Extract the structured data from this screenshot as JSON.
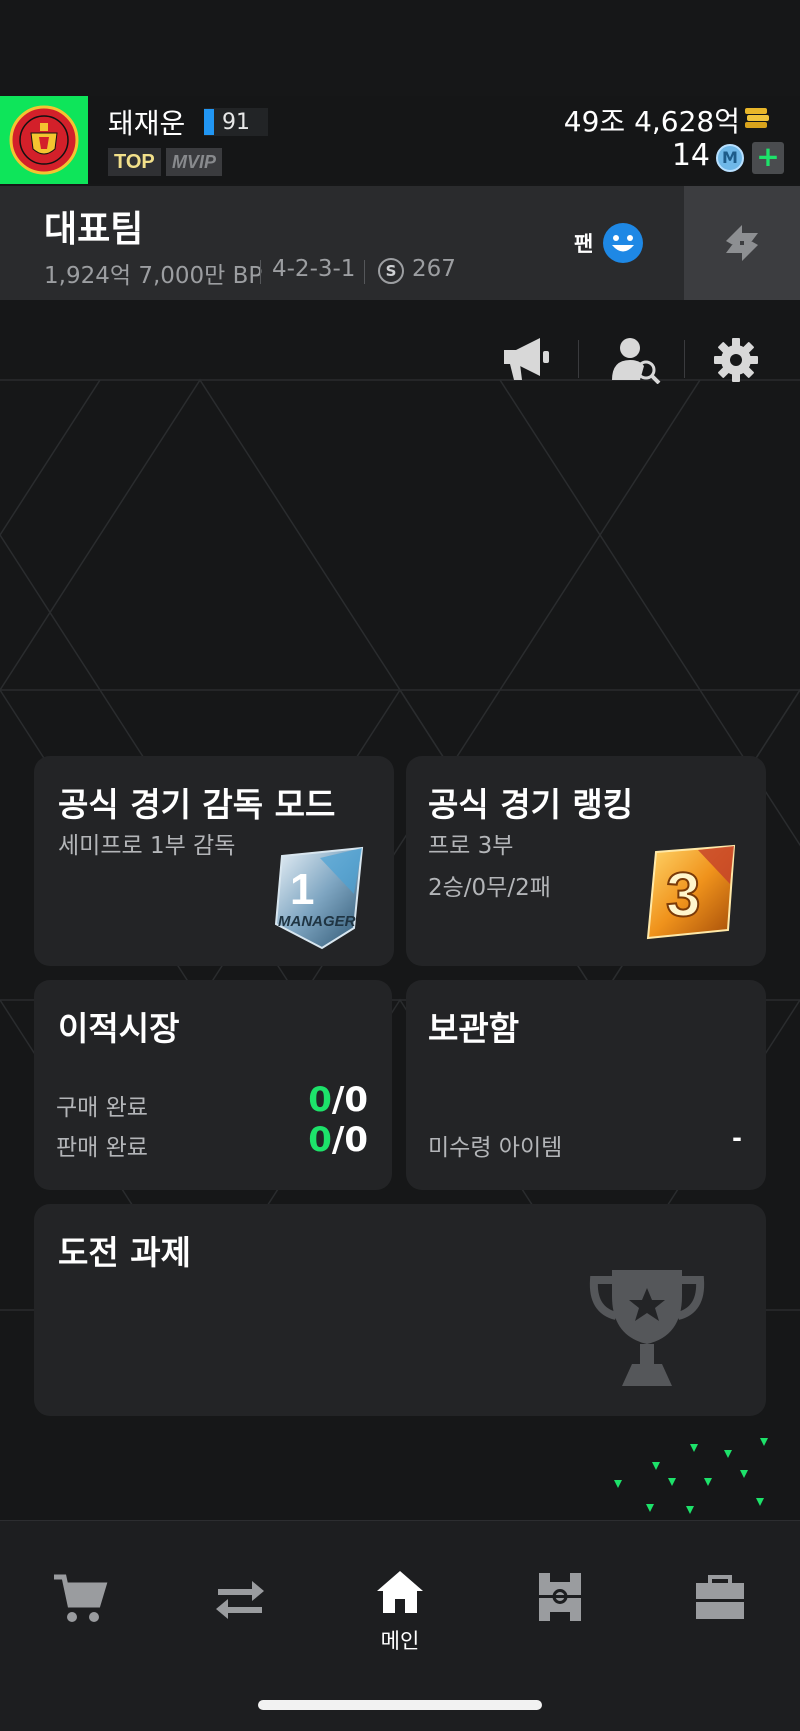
{
  "header": {
    "nickname": "돼재운",
    "level": "91",
    "badge_top": "TOP",
    "badge_vip": "VIP",
    "gold": "49조 4,628억",
    "mcoin": "14",
    "mcoin_symbol": "M",
    "add_label": "+"
  },
  "team": {
    "title": "대표팀",
    "bp": "1,924억 7,000만 BP",
    "formation": "4-2-3-1",
    "salary_symbol": "S",
    "salary": "267",
    "fan_label": "팬"
  },
  "cards": {
    "manager_mode": {
      "title": "공식 경기 감독 모드",
      "division": "세미프로 1부 감독",
      "emblem_number": "1",
      "emblem_text": "MANAGER"
    },
    "ranking": {
      "title": "공식 경기 랭킹",
      "division": "프로 3부",
      "record": "2승/0무/2패",
      "emblem_number": "3"
    },
    "transfer": {
      "title": "이적시장",
      "buy_label": "구매 완료",
      "buy_done": "0",
      "buy_total": "/0",
      "sell_label": "판매 완료",
      "sell_done": "0",
      "sell_total": "/0"
    },
    "storage": {
      "title": "보관함",
      "unclaimed_label": "미수령 아이템",
      "unclaimed_value": "-"
    },
    "challenge": {
      "title": "도전 과제"
    }
  },
  "nav": {
    "items": [
      {
        "icon": "cart-icon",
        "label": ""
      },
      {
        "icon": "transfer-arrows-icon",
        "label": ""
      },
      {
        "icon": "home-icon",
        "label": "메인"
      },
      {
        "icon": "pitch-icon",
        "label": ""
      },
      {
        "icon": "briefcase-icon",
        "label": ""
      }
    ]
  },
  "colors": {
    "accent_green": "#1de26a",
    "crest_bg": "#0ee55a",
    "card_bg": "#232426",
    "team_bar_bg": "#2a2b2d"
  }
}
